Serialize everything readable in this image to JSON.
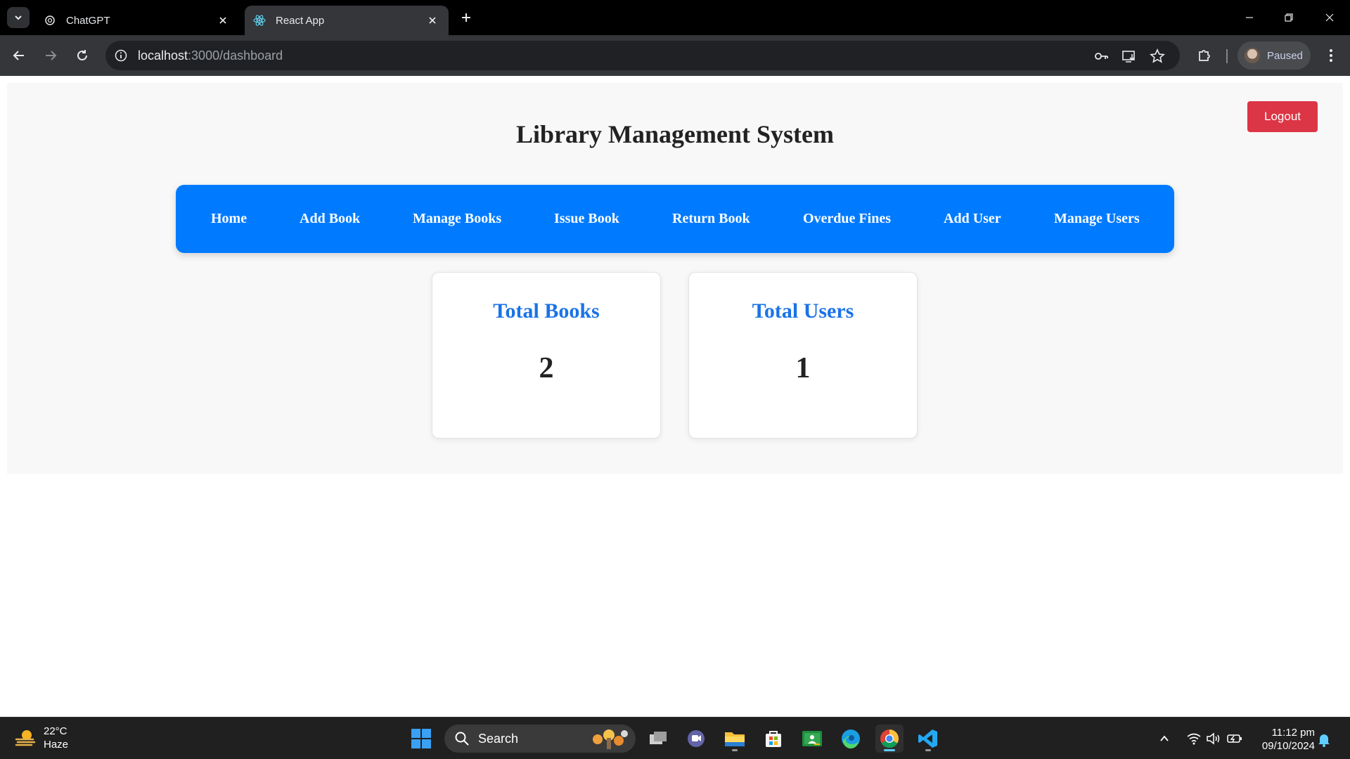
{
  "browser": {
    "tabs": [
      {
        "title": "ChatGPT",
        "icon": "chatgpt-icon",
        "active": false
      },
      {
        "title": "React App",
        "icon": "react-icon",
        "active": true
      }
    ],
    "url_host": "localhost",
    "url_rest": ":3000/dashboard",
    "profile_status": "Paused"
  },
  "page": {
    "title": "Library Management System",
    "logout_label": "Logout",
    "nav": {
      "home": "Home",
      "add_book": "Add Book",
      "manage_books": "Manage Books",
      "issue_book": "Issue Book",
      "return_book": "Return Book",
      "overdue_fines": "Overdue Fines",
      "add_user": "Add User",
      "manage_users": "Manage Users"
    },
    "cards": [
      {
        "title": "Total Books",
        "value": "2"
      },
      {
        "title": "Total Users",
        "value": "1"
      }
    ],
    "colors": {
      "nav_bg": "#007bff",
      "logout_bg": "#dc3545",
      "card_title": "#1a73e8"
    }
  },
  "taskbar": {
    "weather_temp": "22°C",
    "weather_desc": "Haze",
    "search_label": "Search",
    "time": "11:12 pm",
    "date": "09/10/2024"
  }
}
